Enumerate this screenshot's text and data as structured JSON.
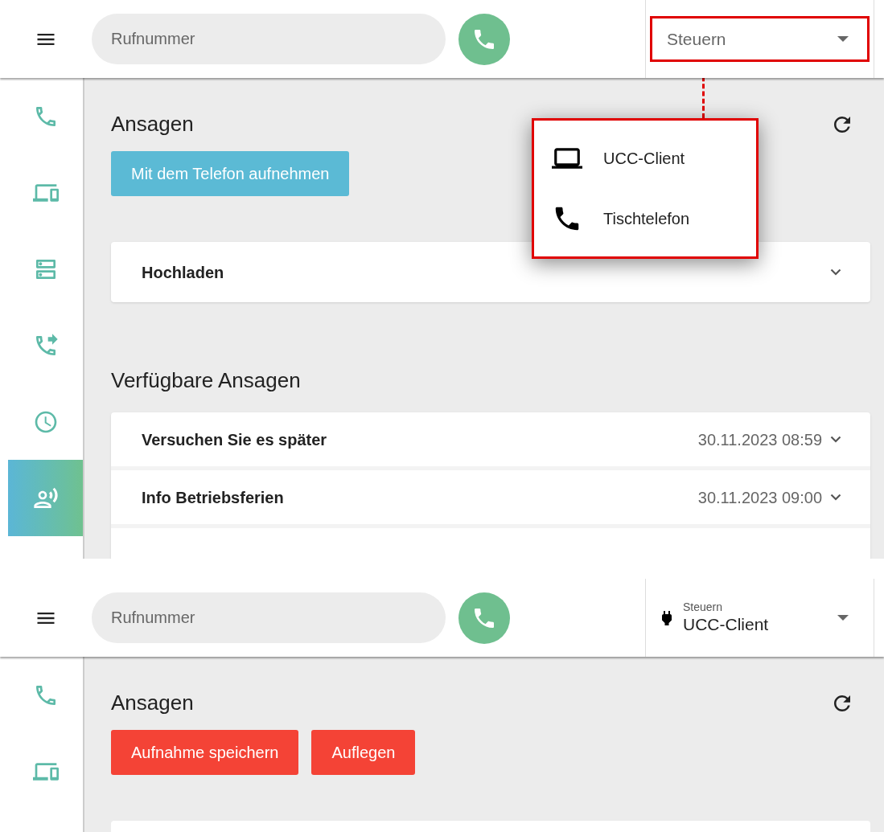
{
  "screens": [
    {
      "header": {
        "search": {
          "placeholder": "Rufnummer"
        },
        "control": {
          "label": "Steuern",
          "annotated": true
        }
      },
      "sidebar": {
        "items": [
          {
            "selected": false
          },
          {
            "selected": false
          },
          {
            "selected": false
          },
          {
            "selected": false
          },
          {
            "selected": false
          },
          {
            "selected": true
          }
        ]
      },
      "content": {
        "title": "Ansagen",
        "buttons": [
          {
            "label": "Mit dem Telefon aufnehmen",
            "kind": "info"
          }
        ],
        "upload": {
          "title": "Hochladen",
          "expanded": false
        },
        "list_title": "Verfügbare Ansagen",
        "announcements": [
          {
            "name": "Versuchen Sie es später",
            "date": "30.11.2023 08:59",
            "expanded": false
          },
          {
            "name": "Info Betriebsferien",
            "date": "30.11.2023 09:00",
            "expanded": false
          }
        ]
      },
      "menu": {
        "annotated": true,
        "options": [
          {
            "label": "UCC-Client",
            "kind": "laptop"
          },
          {
            "label": "Tischtelefon",
            "kind": "phone"
          }
        ]
      }
    },
    {
      "header": {
        "search": {
          "placeholder": "Rufnummer"
        },
        "control": {
          "label": "Steuern",
          "value": "UCC-Client",
          "annotated": false
        }
      },
      "sidebar": {
        "items": [
          {
            "selected": false
          },
          {
            "selected": false
          }
        ]
      },
      "content": {
        "title": "Ansagen",
        "buttons": [
          {
            "label": "Aufnahme speichern",
            "kind": "danger"
          },
          {
            "label": "Auflegen",
            "kind": "danger"
          }
        ]
      }
    }
  ]
}
